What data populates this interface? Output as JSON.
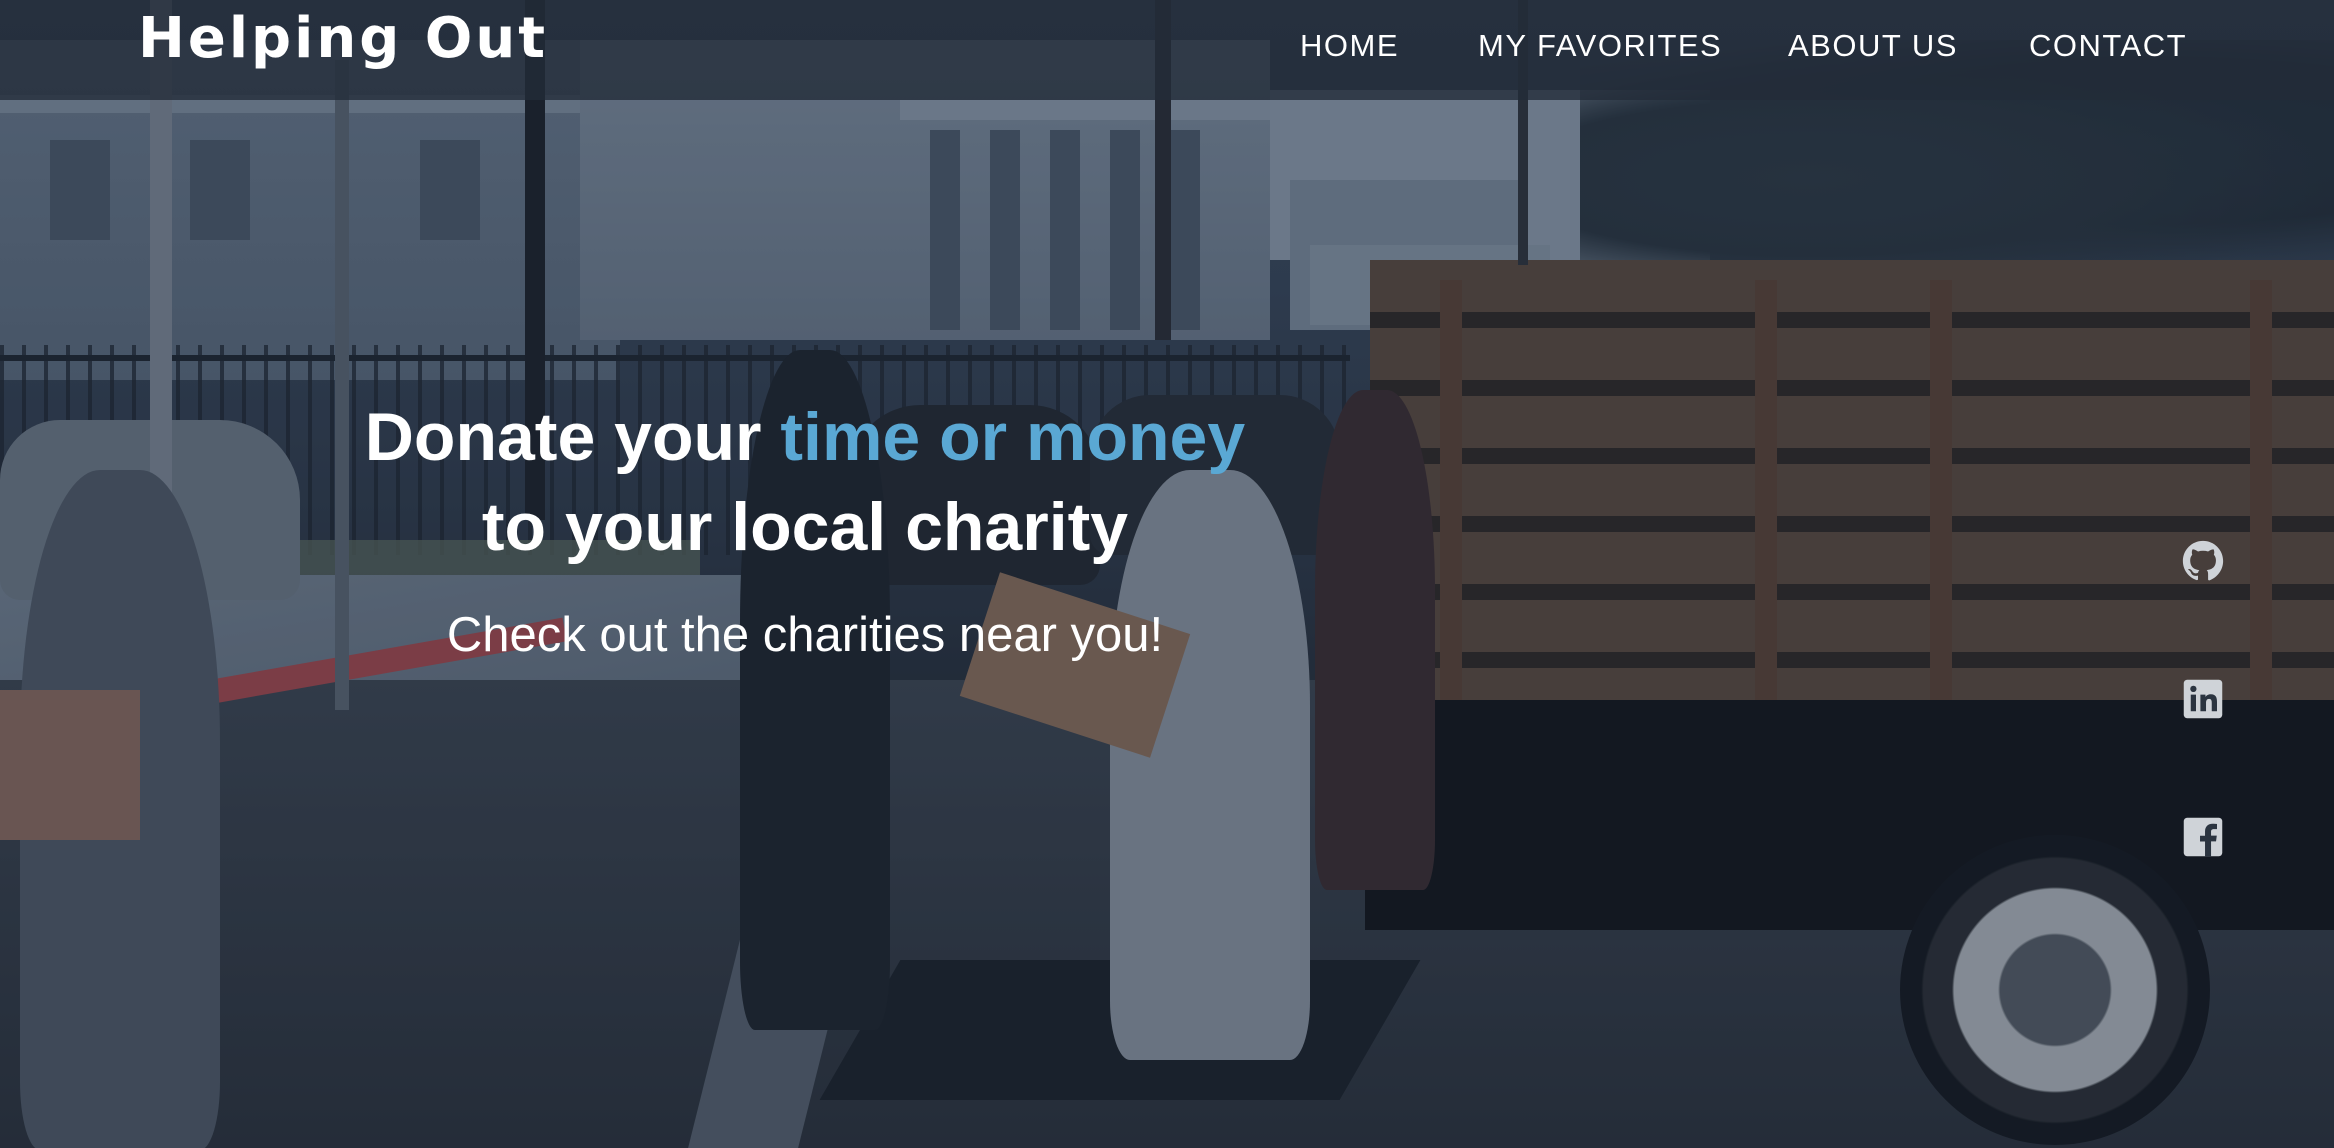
{
  "brand": {
    "name": "Helping Out"
  },
  "nav": {
    "items": [
      {
        "label": "HOME"
      },
      {
        "label": "MY FAVORITES"
      },
      {
        "label": "ABOUT US"
      },
      {
        "label": "CONTACT"
      }
    ]
  },
  "hero": {
    "headline_part1": "Donate your ",
    "headline_accent": "time or money",
    "headline_line2": "to your local charity",
    "subtitle": "Check out the charities near you!"
  },
  "social": {
    "icons": [
      "github-icon",
      "linkedin-icon",
      "facebook-icon"
    ]
  },
  "colors": {
    "accent": "#5aa8d4",
    "navbar_bg": "#232c38",
    "text": "#ffffff",
    "icon": "#cfd3d8"
  }
}
